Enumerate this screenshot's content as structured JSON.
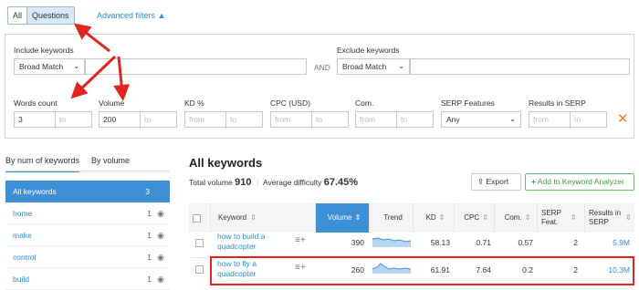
{
  "toggle": {
    "all": "All",
    "questions": "Questions"
  },
  "advanced_filters": "Advanced filters",
  "filters": {
    "include_label": "Include keywords",
    "exclude_label": "Exclude keywords",
    "include_match": "Broad Match",
    "exclude_match": "Broad Match",
    "and_label": "AND",
    "words_count": {
      "label": "Words count",
      "from": "3",
      "to": "to"
    },
    "volume": {
      "label": "Volume",
      "from": "200",
      "to": "to"
    },
    "kd": {
      "label": "KD %",
      "from": "from",
      "to": "to"
    },
    "cpc": {
      "label": "CPC (USD)",
      "from": "from",
      "to": "to"
    },
    "com": {
      "label": "Com.",
      "from": "from",
      "to": "to"
    },
    "serp_features": {
      "label": "SERP Features",
      "value": "Any"
    },
    "results_in_serp": {
      "label": "Results in SERP",
      "from": "from",
      "to": "to"
    }
  },
  "sidebar": {
    "tabs": [
      "By num of keywords",
      "By volume"
    ],
    "items": [
      {
        "label": "All keywords",
        "count": "3"
      },
      {
        "label": "home",
        "count": "1"
      },
      {
        "label": "make",
        "count": "1"
      },
      {
        "label": "control",
        "count": "1"
      },
      {
        "label": "build",
        "count": "1"
      }
    ]
  },
  "main": {
    "title": "All keywords",
    "total_volume_label": "Total volume",
    "total_volume": "910",
    "avg_difficulty_label": "Average difficulty",
    "avg_difficulty": "67.45%",
    "export_label": "Export",
    "add_label": "Add to Keyword Analyzer"
  },
  "table": {
    "headers": [
      "Keyword",
      "Volume",
      "Trend",
      "KD",
      "CPC",
      "Com.",
      "SERP Feat.",
      "Results in SERP"
    ],
    "rows": [
      {
        "keyword_l1": "how to build a",
        "keyword_l2": "quadcopter",
        "volume": "390",
        "kd": "58.13",
        "cpc": "0.71",
        "com": "0.57",
        "serp": "2",
        "results": "5.9M"
      },
      {
        "keyword_l1": "how to fly a",
        "keyword_l2": "quadcopter",
        "volume": "260",
        "kd": "61.91",
        "cpc": "7.64",
        "com": "0.2",
        "serp": "2",
        "results": "10.3M"
      }
    ]
  },
  "colors": {
    "accent": "#2a8fd6",
    "highlight": "#e0241f",
    "add_green": "#3ca23c"
  }
}
